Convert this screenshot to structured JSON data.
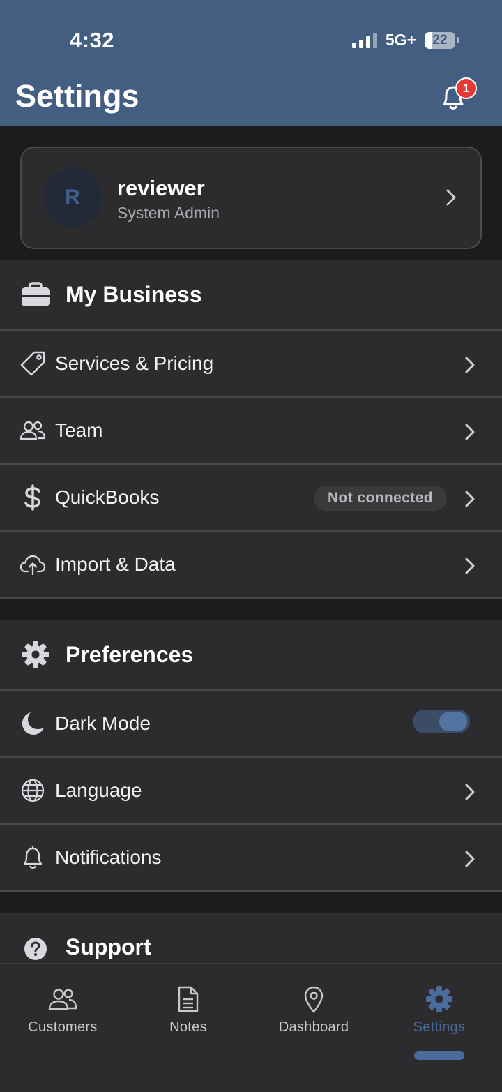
{
  "status_bar": {
    "time": "4:32",
    "network": "5G+",
    "battery": "22",
    "battery_level": 0.22
  },
  "header": {
    "title": "Settings",
    "notification_count": "1"
  },
  "profile": {
    "initial": "R",
    "name": "reviewer",
    "role": "System Admin"
  },
  "my_business": {
    "title": "My Business",
    "items": [
      {
        "label": "Services & Pricing",
        "icon": "tag-icon"
      },
      {
        "label": "Team",
        "icon": "team-icon"
      },
      {
        "label": "QuickBooks",
        "icon": "dollar-icon",
        "status": "Not connected"
      },
      {
        "label": "Import & Data",
        "icon": "cloud-upload-icon"
      }
    ]
  },
  "preferences": {
    "title": "Preferences",
    "items": [
      {
        "label": "Dark Mode",
        "icon": "moon-icon",
        "toggle_on": true
      },
      {
        "label": "Language",
        "icon": "globe-icon"
      },
      {
        "label": "Notifications",
        "icon": "bell-icon"
      }
    ]
  },
  "support": {
    "title": "Support"
  },
  "tabbar": {
    "tabs": [
      {
        "label": "Customers",
        "icon": "people-icon"
      },
      {
        "label": "Notes",
        "icon": "document-icon"
      },
      {
        "label": "Dashboard",
        "icon": "location-pin-icon"
      },
      {
        "label": "Settings",
        "icon": "gear-icon",
        "active": true
      }
    ]
  },
  "colors": {
    "header_bg": "#445e82",
    "accent": "#4a6b9c",
    "badge": "#e53935",
    "surface": "#2c2c2e",
    "background": "#1c1c1e"
  }
}
